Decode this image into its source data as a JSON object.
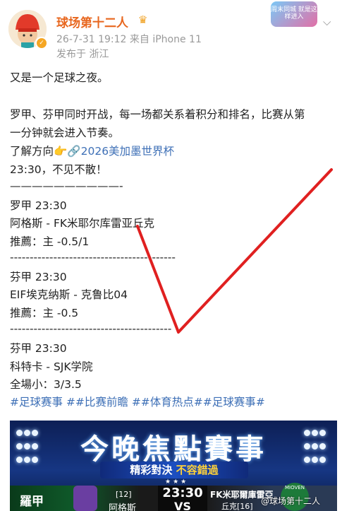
{
  "post": {
    "username": "球场第十二人",
    "meta": "26-7-31 19:12  来自 iPhone 11",
    "location": "发布于 浙江",
    "sticker_text": "周末同城 就是这样进入",
    "lines": {
      "intro": "又是一个足球之夜。",
      "p1a": "罗甲、芬甲同时开战，每一场都关系着积分和排名，比赛从第",
      "p1b": "一分钟就会进入节奏。",
      "learn_prefix": "了解方向👉",
      "learn_link": "🔗2026美加墨世界杯",
      "closing": "23:30，不见不散！",
      "divider_short": "——————————-",
      "m1_league": "罗甲  23:30",
      "m1_teams": "阿格斯  -  FK米耶尔库雷亚丘克",
      "m1_tip": "推薦：主 -0.5/1",
      "divider1": "------------------------------------------",
      "m2_league": "芬甲  23:30",
      "m2_teams": "EIF埃克纳斯  -  克鲁比04",
      "m2_tip": "推薦：主 -0.5",
      "divider2": "-----------------------------------------",
      "m3_league": "芬甲  23:30",
      "m3_teams": "科特卡  -  SJK学院",
      "m3_tip": "全場小：3/3.5",
      "hashtags": "#足球赛事 ##比赛前瞻 ##体育热点##足球赛事#"
    }
  },
  "banner": {
    "title": "今晚焦點賽事",
    "sub_a": "精彩對決 ",
    "sub_b": "不容錯過",
    "stars": "★★★",
    "league": "羅甲",
    "left_rank": "[12]",
    "left_name": "阿格斯",
    "time": "23:30",
    "vs": "VS",
    "right_name": "FK米耶爾庫雷亞",
    "right_name2": "丘克[16]",
    "right_logo_text": "MIOVEN"
  },
  "watermark": "@球场第十二人",
  "colors": {
    "username": "#e8671f",
    "link": "#3d6fb6",
    "checkmark": "#e02020"
  }
}
